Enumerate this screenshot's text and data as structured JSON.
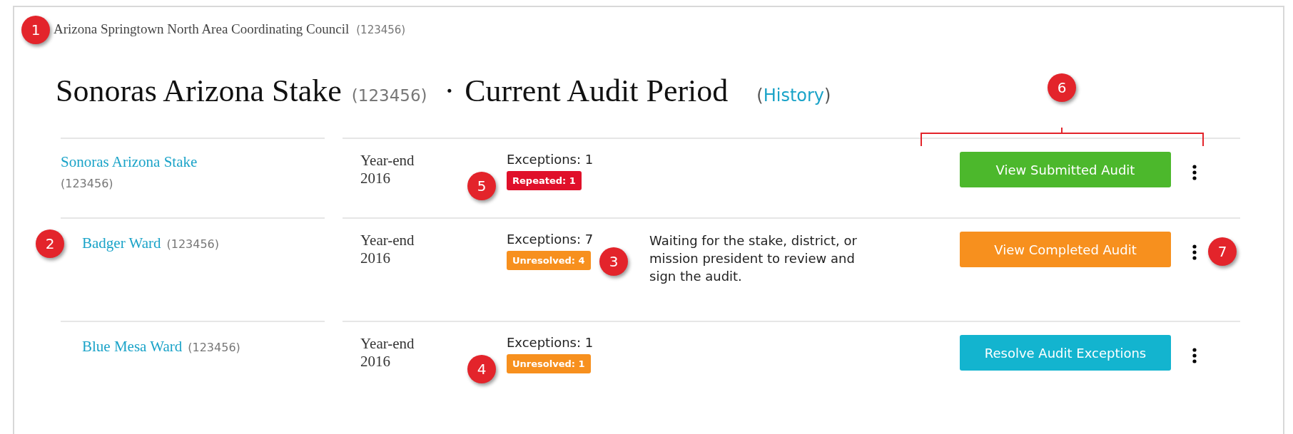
{
  "breadcrumb": {
    "name": "Arizona Springtown North Area Coordinating Council",
    "id": "(123456)",
    "marker": "1"
  },
  "heading": {
    "unit": "Sonoras  Arizona Stake",
    "id": "(123456)",
    "separator": "·",
    "period": "Current Audit Period",
    "history_open": "(",
    "history_link": "History",
    "history_close": ")"
  },
  "callout": {
    "marker": "6"
  },
  "rows": [
    {
      "kind": "stake",
      "name": "Sonoras Arizona Stake",
      "id": "(123456)",
      "period": "Year-end 2016",
      "exceptions": "Exceptions: 1",
      "badge": {
        "label": "Repeated: 1",
        "color": "#e0102a"
      },
      "badge_marker": "5",
      "button": {
        "label": "View Submitted Audit",
        "color": "#4cb82c"
      }
    },
    {
      "kind": "ward",
      "name": "Badger Ward",
      "id": "(123456)",
      "name_marker": "2",
      "period": "Year-end 2016",
      "exceptions": "Exceptions: 7",
      "badge": {
        "label": "Unresolved: 4",
        "color": "#f7901e"
      },
      "note_marker": "3",
      "note": "Waiting for the stake, district, or mission president to review and sign the audit.",
      "button": {
        "label": "View Completed Audit",
        "color": "#f7901e"
      },
      "menu_marker": "7"
    },
    {
      "kind": "ward",
      "name": "Blue Mesa Ward",
      "id": "(123456)",
      "period": "Year-end 2016",
      "exceptions": "Exceptions: 1",
      "badge": {
        "label": "Unresolved: 1",
        "color": "#f7901e"
      },
      "badge_marker": "4",
      "button": {
        "label": "Resolve Audit Exceptions",
        "color": "#13b4cf"
      }
    }
  ]
}
